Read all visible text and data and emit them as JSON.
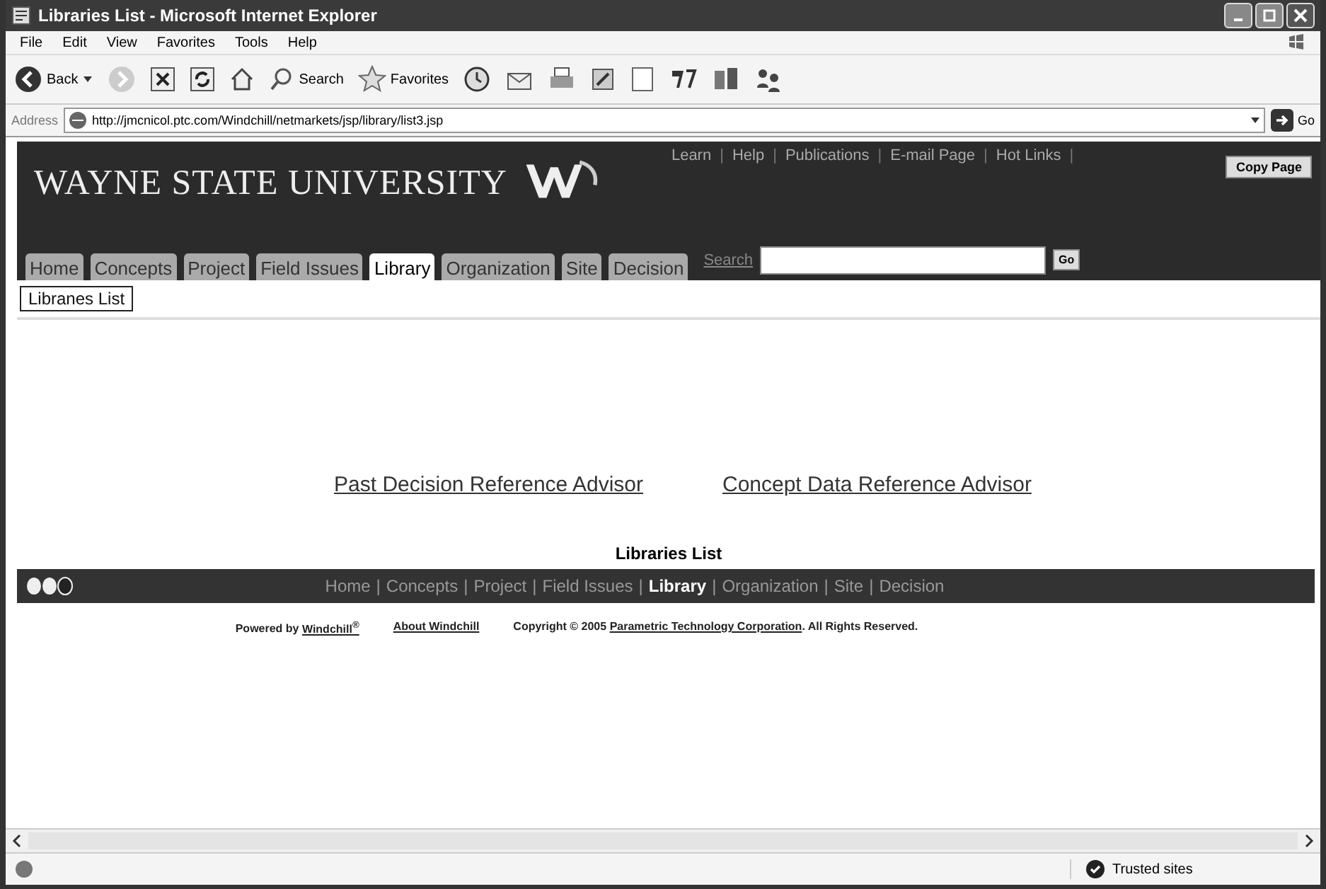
{
  "window": {
    "title": "Libraries List - Microsoft Internet Explorer"
  },
  "menu": [
    "File",
    "Edit",
    "View",
    "Favorites",
    "Tools",
    "Help"
  ],
  "toolbar": {
    "back": "Back",
    "search": "Search",
    "favorites": "Favorites"
  },
  "address": {
    "label": "Address",
    "value": "http://jmcnicol.ptc.com/Windchill/netmarkets/jsp/library/list3.jsp",
    "go": "Go"
  },
  "header": {
    "logo": "WAYNE STATE UNIVERSITY",
    "links": [
      {
        "kind": "link",
        "label": "Learn"
      },
      {
        "kind": "sep",
        "label": "|"
      },
      {
        "kind": "link",
        "label": "Help"
      },
      {
        "kind": "sep",
        "label": "|"
      },
      {
        "kind": "link",
        "label": "Publications"
      },
      {
        "kind": "sep",
        "label": "|"
      },
      {
        "kind": "link",
        "label": "E-mail Page"
      },
      {
        "kind": "sep",
        "label": "|"
      },
      {
        "kind": "link",
        "label": "Hot Links"
      },
      {
        "kind": "sep",
        "label": "|"
      }
    ],
    "copy_button": "Copy Page",
    "search_label": "Search",
    "search_go": "Go"
  },
  "tabs": [
    {
      "label": "Home",
      "selected": false
    },
    {
      "label": "Concepts",
      "selected": false
    },
    {
      "label": "Project",
      "selected": false
    },
    {
      "label": "Field Issues",
      "selected": false
    },
    {
      "label": "Library",
      "selected": true
    },
    {
      "label": "Organization",
      "selected": false
    },
    {
      "label": "Site",
      "selected": false
    },
    {
      "label": "Decision",
      "selected": false
    }
  ],
  "subtabs": [
    {
      "label": "Libranes List",
      "selected": true
    }
  ],
  "content_links": [
    "Past Decision Reference Advisor",
    "Concept Data Reference Advisor"
  ],
  "page_title": "Libraries List",
  "footer_nav": [
    {
      "kind": "link",
      "label": "Home",
      "selected": false
    },
    {
      "kind": "sep",
      "label": "|"
    },
    {
      "kind": "link",
      "label": "Concepts",
      "selected": false
    },
    {
      "kind": "sep",
      "label": "|"
    },
    {
      "kind": "link",
      "label": "Project",
      "selected": false
    },
    {
      "kind": "sep",
      "label": "|"
    },
    {
      "kind": "link",
      "label": "Field Issues",
      "selected": false
    },
    {
      "kind": "sep",
      "label": "|"
    },
    {
      "kind": "link",
      "label": "Library",
      "selected": true
    },
    {
      "kind": "sep",
      "label": "|"
    },
    {
      "kind": "link",
      "label": "Organization",
      "selected": false
    },
    {
      "kind": "sep",
      "label": "|"
    },
    {
      "kind": "link",
      "label": "Site",
      "selected": false
    },
    {
      "kind": "sep",
      "label": "|"
    },
    {
      "kind": "link",
      "label": "Decision",
      "selected": false
    }
  ],
  "legal": {
    "powered": "Powered by",
    "windchill": "Windchill$^{®}$",
    "about": "About Windchill",
    "copyright": "Copyright © 2005",
    "company": "Parametric Technology Corporation",
    "rights": ". All Rights Reserved."
  },
  "status_bar": {
    "zone": "Trusted sites"
  }
}
